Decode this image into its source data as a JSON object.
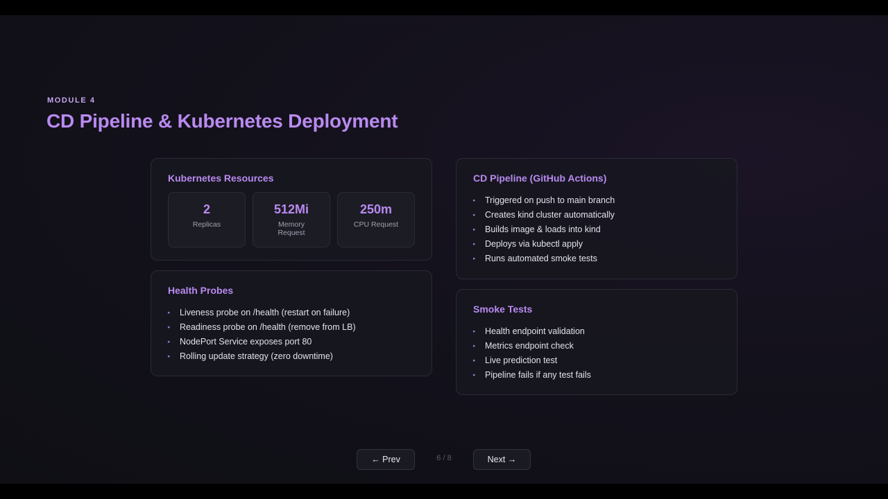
{
  "header": {
    "module_label": "MODULE 4",
    "title": "CD Pipeline & Kubernetes Deployment"
  },
  "k8s_resources": {
    "title": "Kubernetes Resources",
    "stats": [
      {
        "value": "2",
        "label": "Replicas"
      },
      {
        "value": "512Mi",
        "label": "Memory Request"
      },
      {
        "value": "250m",
        "label": "CPU Request"
      }
    ]
  },
  "health_probes": {
    "title": "Health Probes",
    "items": [
      "Liveness probe on /health (restart on failure)",
      "Readiness probe on /health (remove from LB)",
      "NodePort Service exposes port 80",
      "Rolling update strategy (zero downtime)"
    ]
  },
  "cd_pipeline": {
    "title": "CD Pipeline (GitHub Actions)",
    "items": [
      "Triggered on push to main branch",
      "Creates kind cluster automatically",
      "Builds image & loads into kind",
      "Deploys via kubectl apply",
      "Runs automated smoke tests"
    ]
  },
  "smoke_tests": {
    "title": "Smoke Tests",
    "items": [
      "Health endpoint validation",
      "Metrics endpoint check",
      "Live prediction test",
      "Pipeline fails if any test fails"
    ]
  },
  "bullet_glyph": "▸",
  "navigation": {
    "prev_label": "← Prev",
    "next_label": "Next →",
    "page_counter": "6 / 8"
  },
  "colors": {
    "accent": "#b98af0",
    "background": "#13111b",
    "card": "#181820"
  }
}
